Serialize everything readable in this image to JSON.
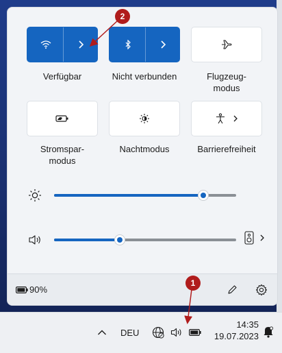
{
  "quick_settings": {
    "tiles": [
      {
        "label": "Verfügbar",
        "icon": "wifi-icon",
        "active": true,
        "split": true
      },
      {
        "label": "Nicht verbunden",
        "icon": "bluetooth-icon",
        "active": true,
        "split": true
      },
      {
        "label": "Flugzeug-\nmodus",
        "icon": "airplane-icon",
        "active": false
      },
      {
        "label": "Stromspar-\nmodus",
        "icon": "battery-saver-icon",
        "active": false
      },
      {
        "label": "Nachtmodus",
        "icon": "night-light-icon",
        "active": false
      },
      {
        "label": "Barrierefreiheit",
        "icon": "accessibility-icon",
        "active": false,
        "chevron": true
      }
    ],
    "brightness": {
      "icon": "brightness-icon",
      "level_percent": 82
    },
    "volume": {
      "icon": "speaker-icon",
      "level_percent": 36,
      "output_icon": "audio-device-icon"
    },
    "footer": {
      "battery_icon": "battery-icon",
      "battery_text": "90%",
      "edit_icon": "pencil-icon",
      "settings_icon": "gear-icon"
    }
  },
  "taskbar": {
    "language": "DEU",
    "time": "14:35",
    "date": "19.07.2023",
    "tray_icons": [
      "chevron-up-icon",
      "network-icon",
      "speaker-icon",
      "battery-icon",
      "notification-icon"
    ]
  },
  "annotations": {
    "badge_1": "1",
    "badge_2": "2"
  },
  "colors": {
    "accent": "#1565c0",
    "annotation": "#b01c1c"
  }
}
